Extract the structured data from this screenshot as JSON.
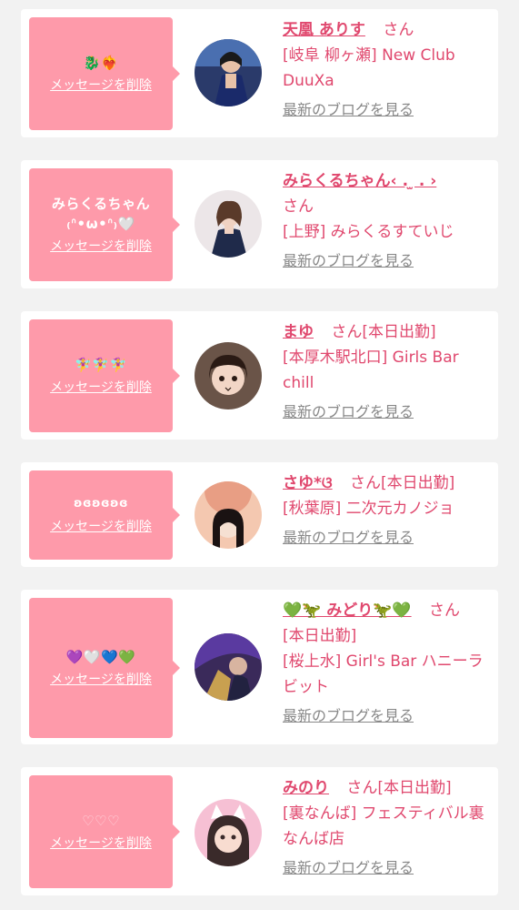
{
  "items": [
    {
      "message": "🐉❤️‍🔥",
      "delete_label": "メッセージを削除",
      "name": "天凰 ありす",
      "suffix": "さん",
      "store": "[岐阜 柳ヶ瀬] New Club DuuXa",
      "blog_label": "最新のブログを見る"
    },
    {
      "message": "みらくるちゃん\n₍ᐢ•ω•ᐢ₎🤍",
      "delete_label": "メッセージを削除",
      "name": "みらくるちゃん‹ . ̫ . ›",
      "suffix": "さん",
      "store": "[上野] みらくるすていじ",
      "blog_label": "最新のブログを見る"
    },
    {
      "message": "🧚‍♀️🧚‍♀️🧚‍♀️",
      "delete_label": "メッセージを削除",
      "name": "まゆ",
      "suffix": "さん[本日出勤]",
      "store": "[本厚木駅北口] Girls Bar chill",
      "blog_label": "最新のブログを見る"
    },
    {
      "message": "ʚɞʚɞʚɞ",
      "delete_label": "メッセージを削除",
      "name": "さゆ*ଓ",
      "suffix": "さん[本日出勤]",
      "store": "[秋葉原] 二次元カノジョ",
      "blog_label": "最新のブログを見る"
    },
    {
      "message": "💜🤍💙💚",
      "delete_label": "メッセージを削除",
      "name": "💚🦖 みどり🦖💚",
      "suffix": "さん",
      "status": "[本日出勤]",
      "store": "[桜上水] Girl's Bar ハニーラビット",
      "blog_label": "最新のブログを見る"
    },
    {
      "message": "♡♡♡",
      "delete_label": "メッセージを削除",
      "name": "みのり",
      "suffix": "さん[本日出勤]",
      "store": "[裏なんば] フェスティバル裏なんば店",
      "blog_label": "最新のブログを見る"
    }
  ],
  "colors": {
    "bubble": "#fe9aaa",
    "name": "#e0486e",
    "link_gray": "#888888",
    "background": "#f2f2f2"
  }
}
